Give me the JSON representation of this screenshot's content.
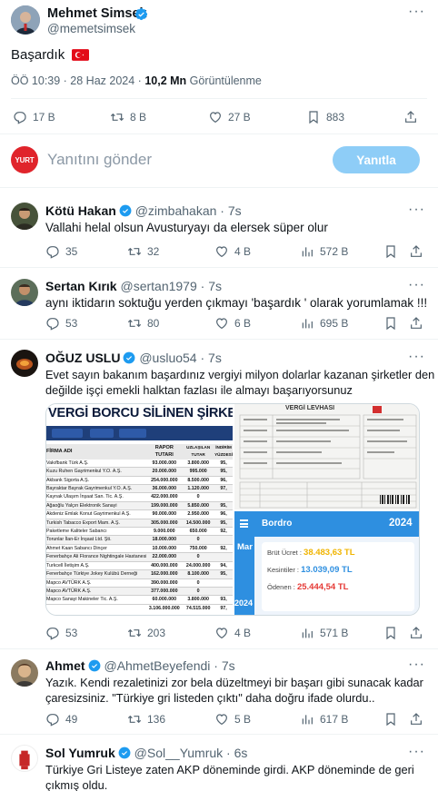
{
  "main_tweet": {
    "display_name": "Mehmet Simsek",
    "handle": "@memetsimsek",
    "text": "Başardık",
    "time": "ÖÖ 10:39 · 28 Haz 2024 · ",
    "views_count": "10,2 Mn",
    "views_label": "Görüntülenme",
    "stats": {
      "replies": "17 B",
      "retweets": "8 B",
      "likes": "27 B",
      "bookmarks": "883"
    }
  },
  "reply_box": {
    "avatar_text": "YURT",
    "placeholder": "Yanıtını gönder",
    "button_label": "Yanıtla"
  },
  "replies": [
    {
      "name": "Kötü Hakan",
      "handle": "@zimbahakan",
      "time": "· 7s",
      "text": "Vallahi helal olsun Avusturyayı da elersek süper olur",
      "stats": {
        "replies": "35",
        "retweets": "32",
        "likes": "4 B",
        "views": "572 B"
      }
    },
    {
      "name": "Sertan Kırık",
      "handle": "@sertan1979",
      "time": "· 7s",
      "text": "aynı iktidarın soktuğu yerden çıkmayı 'başardık ' olarak yorumlamak !!!",
      "stats": {
        "replies": "53",
        "retweets": "80",
        "likes": "6 B",
        "views": "695 B"
      }
    },
    {
      "name": "OĞUZ USLU",
      "handle": "@usluo54",
      "time": "· 7s",
      "text_line1": "Evet sayın bakanım başardınız vergiyi milyon dolarlar kazanan şirketler den",
      "text_line2": "değilde işçi emekli halktan fazlası ile almayı başarıyorsunuz",
      "stats": {
        "replies": "53",
        "retweets": "203",
        "likes": "4 B",
        "views": "571 B"
      },
      "media_left": {
        "title": "VERGİ BORCU SİLİNEN ŞİRKETLER",
        "col_headers": [
          "FİRMA ADI",
          "RAPOR TUTARI",
          "UZLAŞILAN TUTAR",
          "İNDİRİM YÜZDESİ"
        ],
        "rows": [
          [
            "Vakıfbank Türk A.Ş.",
            "93.000.000",
            "3.800.000",
            "95,"
          ],
          [
            "Kuzu Ruhen Gayrimenkul Y.O. A.Ş.",
            "20.000.000",
            "995.000",
            "95,"
          ],
          [
            "Akbank Sigorta A.Ş.",
            "254.000.000",
            "8.500.000",
            "96,"
          ],
          [
            "Bayraktar Bayrak Gayrimenkul Y.O. A.Ş.",
            "36.000.000",
            "1.120.000",
            "97,"
          ],
          [
            "Kaynak Ulaşım İnşaat San. Tic. A.Ş.",
            "422.000.000",
            "0",
            ""
          ],
          [
            "Ağaoğlu Yalçın Elektronik Sanayi",
            "199.000.000",
            "5.850.000",
            "95,"
          ],
          [
            "Akdeniz Emlak Konut Gayrimenkul A.Ş.",
            "90.000.000",
            "2.950.000",
            "96,"
          ],
          [
            "Turkish Tabacco Export Mam. A.Ş.",
            "305.000.000",
            "14.500.000",
            "95,"
          ],
          [
            "Paketleme Kaliteler Sabancı",
            "9.000.000",
            "650.000",
            "92,"
          ],
          [
            "Torunlar İlan-Er İnşaat Ltd. Şti.",
            "18.000.000",
            "0",
            ""
          ],
          [
            "Ahmet Kaan Sabancı Dinçer",
            "10.000.000",
            "750.000",
            "92,"
          ],
          [
            "Fenerbahçe Ali Florance Nightingale Hastanesi",
            "22.000.000",
            "0",
            ""
          ],
          [
            "Turkcell İletişim A.Ş.",
            "400.000.000",
            "24.000.000",
            "94,"
          ],
          [
            "Fenerbahçe Türkiye Jokey Kulübü Derneği",
            "162.000.000",
            "8.100.000",
            "95,"
          ],
          [
            "Mapco AVTÜRK A.Ş.",
            "390.000.000",
            "0",
            ""
          ],
          [
            "Mapco AVTÜRK A.Ş.",
            "377.000.000",
            "0",
            ""
          ],
          [
            "Mapco Sanayi Makineler Tic. A.Ş.",
            "60.000.000",
            "3.800.000",
            "93,"
          ]
        ],
        "totals": [
          "3.106.000.000",
          "74.515.000",
          "97,"
        ]
      },
      "media_right_top": {
        "title": "VERGİ LEVHASI"
      },
      "media_right_bottom": {
        "header": "Bordro",
        "year": "2024",
        "month": "Mar",
        "gross_label": "Brüt Ücret :",
        "gross_value": "38.483,63 TL",
        "deduction_label": "Kesintiler :",
        "deduction_value": "13.039,09 TL",
        "paid_label": "Ödenen :",
        "paid_value": "25.444,54 TL",
        "side_year": "2024"
      }
    },
    {
      "name": "Ahmet",
      "handle": "@AhmetBeyefendi",
      "time": "· 7s",
      "text_line1": "Yazık. Kendi rezaletinizi zor bela düzeltmeyi bir başarı gibi sunacak kadar",
      "text_line2": "çaresizsiniz. \"Türkiye gri listeden çıktı\" daha doğru ifade olurdu..",
      "stats": {
        "replies": "49",
        "retweets": "136",
        "likes": "5 B",
        "views": "617 B"
      }
    },
    {
      "name": "Sol Yumruk",
      "handle": "@Sol__Yumruk",
      "time": "· 6s",
      "text_line1": "Türkiye Gri Listeye zaten AKP döneminde girdi. AKP döneminde de geri",
      "text_line2": "çıkmış oldu."
    }
  ],
  "colors": {
    "accent": "#1d9bf0",
    "muted": "#536471",
    "yurt_red": "#e0242b",
    "bordro_blue": "#2e8fe0"
  }
}
